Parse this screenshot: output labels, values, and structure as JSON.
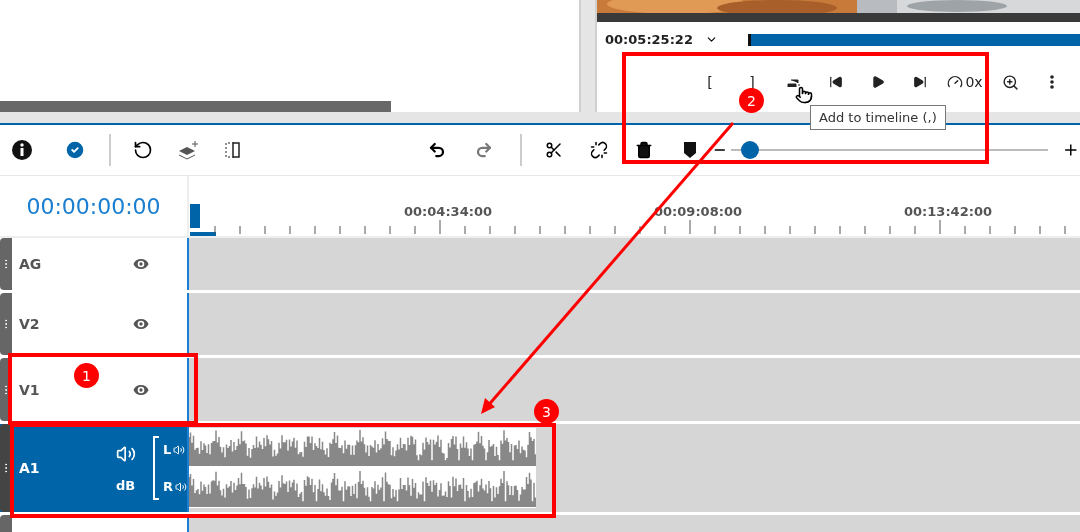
{
  "preview": {
    "timecode": "00:05:25:22",
    "controls": [
      {
        "kind": "text",
        "label": "["
      },
      {
        "kind": "text",
        "label": "]"
      },
      {
        "kind": "add"
      },
      {
        "kind": "prev"
      },
      {
        "kind": "play"
      },
      {
        "kind": "next"
      },
      {
        "kind": "speed",
        "label": "0x"
      },
      {
        "kind": "zoom"
      },
      {
        "kind": "more"
      }
    ],
    "tooltip": "Add to timeline (,)"
  },
  "toolbar": {
    "zoom": {
      "level": 0.03
    }
  },
  "timeline": {
    "current_time": "00:00:00:00",
    "ruler_labels": [
      "00:04:34:00",
      "00:09:08:00",
      "00:13:42:00"
    ],
    "tracks": [
      {
        "name": "AG",
        "kind": "visual",
        "selected": false
      },
      {
        "name": "V2",
        "kind": "visual",
        "selected": false
      },
      {
        "name": "V1",
        "kind": "visual",
        "selected": false
      },
      {
        "name": "A1",
        "kind": "audio",
        "selected": true,
        "db": "dB",
        "left": "L",
        "right": "R"
      }
    ]
  },
  "annotations": [
    {
      "label": "1"
    },
    {
      "label": "2"
    },
    {
      "label": "3"
    }
  ]
}
